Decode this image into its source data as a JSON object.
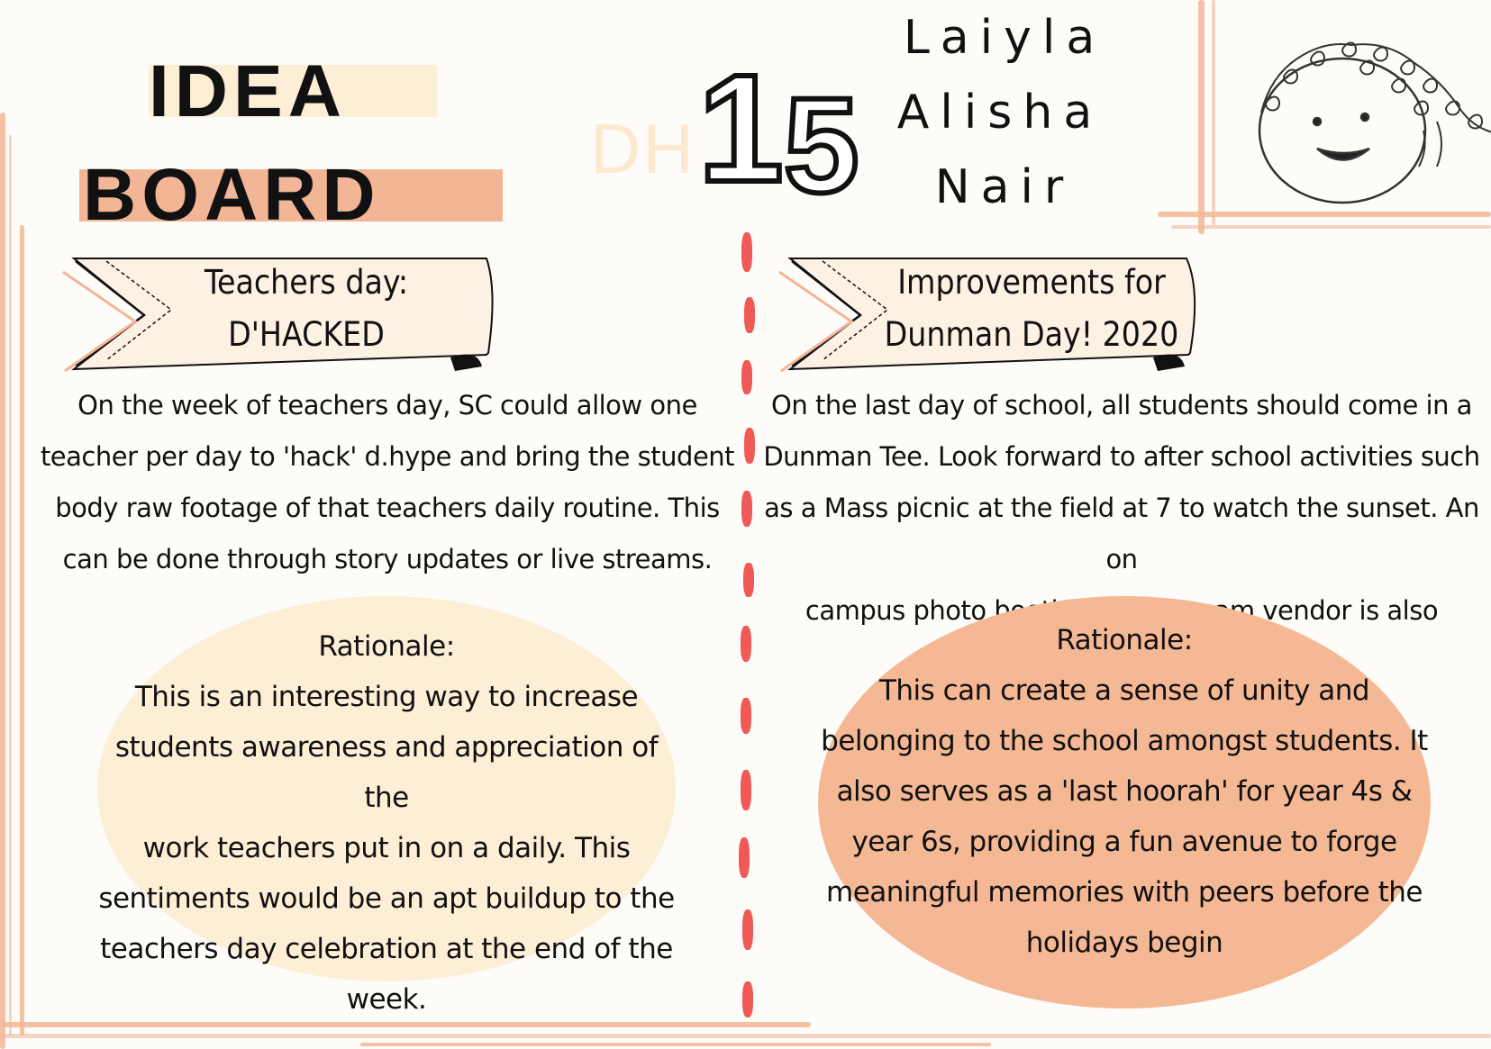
{
  "title": {
    "line1": "IDEA",
    "line2": "BOARD"
  },
  "badge": {
    "prefix": "DH",
    "digit1": "1",
    "digit2": "5"
  },
  "author": {
    "first": "Laiyla",
    "middle": "Alisha",
    "last": "Nair"
  },
  "left": {
    "banner_line1": "Teachers day:",
    "banner_line2": "D'HACKED",
    "description": [
      "On the week of teachers day, SC could allow one",
      "teacher per day to 'hack' d.hype and bring the student",
      "body raw footage of that teachers daily routine. This",
      "can be done through story updates or live streams."
    ],
    "rationale_heading": "Rationale:",
    "rationale": [
      "This is an interesting way to increase",
      "students awareness and appreciation of the",
      "work teachers put in on a daily. This",
      "sentiments would  be an apt buildup to the",
      "teachers day celebration at the end of the",
      "week."
    ]
  },
  "right": {
    "banner_line1": "Improvements for",
    "banner_line2": "Dunman Day! 2020",
    "description": [
      "On the last day of school, all students should come in a",
      "Dunman Tee. Look forward to after school activities such",
      "as a Mass picnic at the field at 7 to watch the sunset. An on",
      "campus photo booth and ice cream vendor is also possible"
    ],
    "rationale_heading": "Rationale:",
    "rationale": [
      "This can create a sense of unity and",
      "belonging to the school amongst students. It",
      "also serves as a 'last hoorah' for year 4s &",
      "year 6s, providing a fun avenue to  forge",
      "meaningful  memories with peers  before the",
      "holidays begin"
    ]
  },
  "colors": {
    "peach": "#f2b697",
    "cream": "#fdeed6",
    "salmon": "#f5b895",
    "red_dots": "#ef5a57",
    "dh_text": "#fde9cf"
  },
  "icons": {
    "portrait": "doodle-face-icon",
    "banner": "chevron-ribbon-icon"
  }
}
